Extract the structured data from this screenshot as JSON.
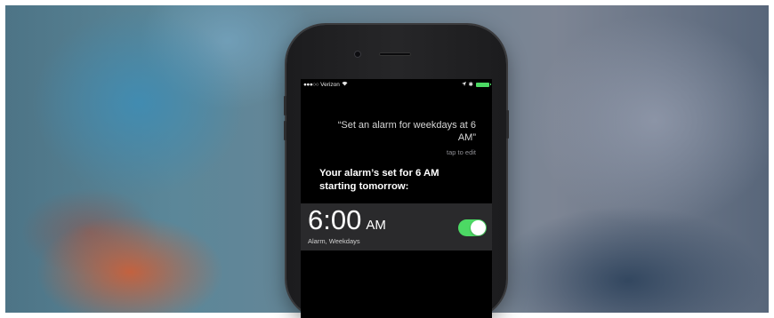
{
  "status_bar": {
    "carrier": "Verizon",
    "signal_icon": "signal-dots-icon",
    "wifi_icon": "wifi-icon",
    "location_icon": "location-icon",
    "bluetooth_icon": "bluetooth-icon",
    "battery_icon": "battery-icon",
    "battery_color": "#4cd964"
  },
  "siri": {
    "query_line1": "“Set an alarm for weekdays at 6",
    "query_line2": "AM”",
    "tap_to_edit": "tap to edit",
    "response_line1": "Your alarm’s set for 6 AM",
    "response_line2": "starting tomorrow:"
  },
  "alarm": {
    "time": "6:00",
    "ampm": "AM",
    "label": "Alarm, Weekdays",
    "enabled": true,
    "toggle_color": "#4cd964"
  }
}
